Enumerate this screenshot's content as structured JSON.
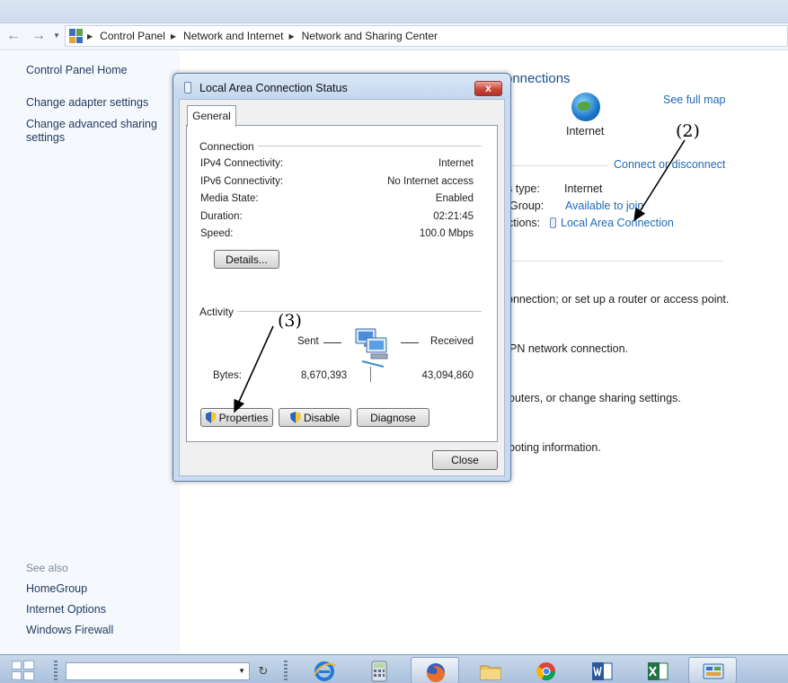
{
  "address_bar": {
    "breadcrumbs": [
      "Control Panel",
      "Network and Internet",
      "Network and Sharing Center"
    ]
  },
  "left_pane": {
    "home_link": "Control Panel Home",
    "links": [
      "Change adapter settings",
      "Change advanced sharing settings"
    ],
    "see_also_heading": "See also",
    "see_also_links": [
      "HomeGroup",
      "Internet Options",
      "Windows Firewall"
    ]
  },
  "main": {
    "heading_fragment": "onnections",
    "internet_label": "Internet",
    "see_full_map": "See full map",
    "connect_or_disconnect": "Connect or disconnect",
    "access_type_label": "s type:",
    "access_type_value": "Internet",
    "homegroup_label": "Group:",
    "homegroup_value": "Available to join",
    "connections_label": "ctions:",
    "connections_value": "Local Area Connection",
    "task_lines": [
      "onnection; or set up a router or access point.",
      "PN network connection.",
      "outers, or change sharing settings.",
      "ooting information."
    ]
  },
  "annotations": {
    "label_2": "(2)",
    "label_3": "(3)"
  },
  "dialog": {
    "title": "Local Area Connection Status",
    "close_x": "x",
    "tab": "General",
    "connection_group": "Connection",
    "rows": [
      {
        "label": "IPv4 Connectivity:",
        "value": "Internet"
      },
      {
        "label": "IPv6 Connectivity:",
        "value": "No Internet access"
      },
      {
        "label": "Media State:",
        "value": "Enabled"
      },
      {
        "label": "Duration:",
        "value": "02:21:45"
      },
      {
        "label": "Speed:",
        "value": "100.0 Mbps"
      }
    ],
    "details_button": "Details...",
    "activity_group": "Activity",
    "sent_label": "Sent",
    "received_label": "Received",
    "bytes_label": "Bytes:",
    "bytes_sent": "8,670,393",
    "bytes_received": "43,094,860",
    "properties_button": "Properties",
    "disable_button": "Disable",
    "diagnose_button": "Diagnose",
    "close_button": "Close"
  },
  "taskbar": {
    "apps": [
      "internet-explorer",
      "calculator",
      "firefox",
      "file-explorer",
      "chrome",
      "word",
      "excel",
      "control-panel"
    ]
  }
}
